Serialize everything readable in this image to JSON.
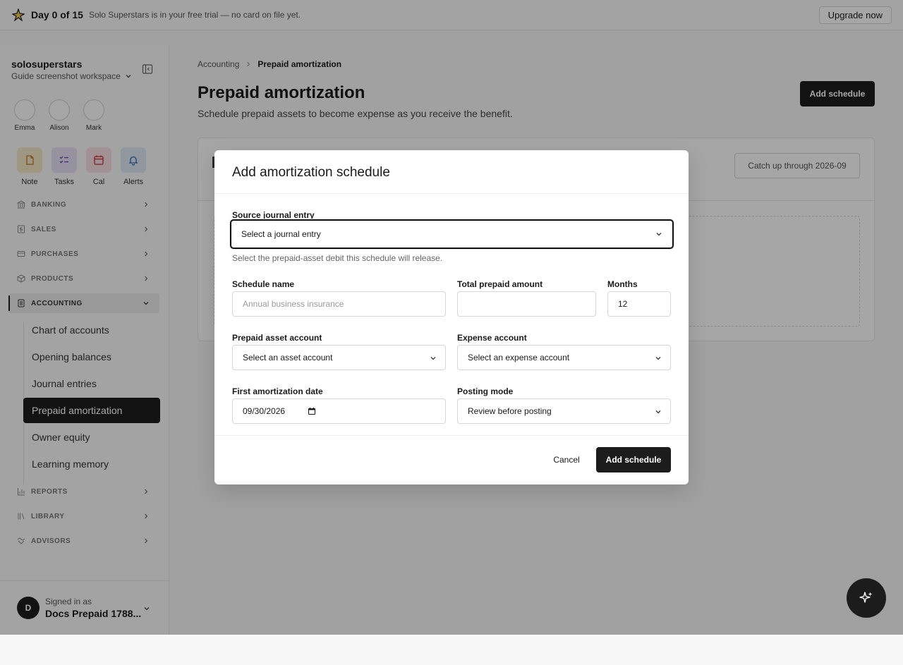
{
  "banner": {
    "day_label": "Day 0 of 15",
    "message": "Solo Superstars is in your free trial — no card on file yet.",
    "upgrade_label": "Upgrade now"
  },
  "workspace": {
    "name": "solosuperstars",
    "subtitle": "Guide screenshot workspace"
  },
  "people": [
    {
      "name": "Emma"
    },
    {
      "name": "Alison"
    },
    {
      "name": "Mark"
    }
  ],
  "quick_actions": [
    {
      "label": "Note",
      "icon": "note-icon",
      "color": "#f6e9c8"
    },
    {
      "label": "Tasks",
      "icon": "tasks-icon",
      "color": "#e6e1f5"
    },
    {
      "label": "Cal",
      "icon": "calendar-icon",
      "color": "#f7dde3"
    },
    {
      "label": "Alerts",
      "icon": "bell-icon",
      "color": "#dde9f4"
    }
  ],
  "nav": {
    "banking": "BANKING",
    "sales": "SALES",
    "purchases": "PURCHASES",
    "products": "PRODUCTS",
    "accounting": "ACCOUNTING",
    "reports": "REPORTS",
    "library": "LIBRARY",
    "advisors": "ADVISORS",
    "accounting_sub": [
      "Chart of accounts",
      "Opening balances",
      "Journal entries",
      "Prepaid amortization",
      "Owner equity",
      "Learning memory"
    ]
  },
  "user": {
    "initial": "D",
    "signed_in_label": "Signed in as",
    "name": "Docs Prepaid 1788..."
  },
  "page": {
    "breadcrumb_parent": "Accounting",
    "breadcrumb_current": "Prepaid amortization",
    "title": "Prepaid amortization",
    "description": "Schedule prepaid assets to become expense as you receive the benefit.",
    "add_button": "Add schedule",
    "catch_up_button": "Catch up through 2026-09"
  },
  "modal": {
    "title": "Add amortization schedule",
    "source_label": "Source journal entry",
    "source_value": "Select a journal entry",
    "source_help": "Select the prepaid-asset debit this schedule will release.",
    "schedule_name_label": "Schedule name",
    "schedule_name_placeholder": "Annual business insurance",
    "total_label": "Total prepaid amount",
    "total_value": "",
    "months_label": "Months",
    "months_value": "12",
    "asset_label": "Prepaid asset account",
    "asset_value": "Select an asset account",
    "expense_label": "Expense account",
    "expense_value": "Select an expense account",
    "first_date_label": "First amortization date",
    "first_date_value": "09/30/2026",
    "posting_label": "Posting mode",
    "posting_value": "Review before posting",
    "cancel": "Cancel",
    "submit": "Add schedule"
  },
  "colors": {
    "primary": "#1c1c1c",
    "overlay": "rgba(0,0,0,0.35)"
  }
}
